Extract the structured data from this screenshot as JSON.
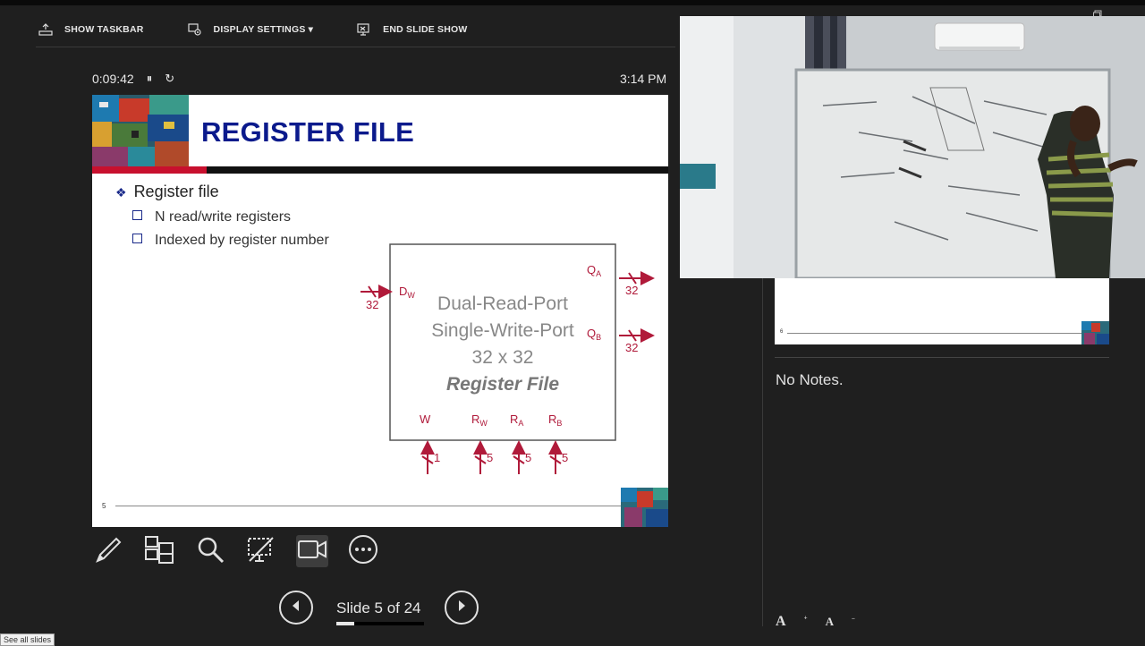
{
  "toolbar": {
    "show_taskbar": "SHOW TASKBAR",
    "display_settings": "DISPLAY SETTINGS ▾",
    "end_slide_show": "END SLIDE SHOW"
  },
  "timer": {
    "elapsed": "0:09:42",
    "pause": "⏸",
    "restart": "↻"
  },
  "clock": "3:14 PM",
  "slide": {
    "title": "REGISTER FILE",
    "bullet_main": "Register file",
    "bullets_sub": [
      "N read/write registers",
      "Indexed by register number"
    ],
    "page_number": "5",
    "diagram": {
      "block_lines": [
        "Dual-Read-Port",
        "Single-Write-Port",
        "32 x 32"
      ],
      "block_title": "Register File",
      "dw": "D",
      "dw_sub": "W",
      "dw_width": "32",
      "qa": "Q",
      "qa_sub": "A",
      "qa_width": "32",
      "qb": "Q",
      "qb_sub": "B",
      "qb_width": "32",
      "w_label": "W",
      "w_width": "1",
      "rw": "R",
      "rw_sub": "W",
      "rw_width": "5",
      "ra": "R",
      "ra_sub": "A",
      "ra_width": "5",
      "rb": "R",
      "rb_sub": "B",
      "rb_width": "5"
    }
  },
  "tools": [
    "pen-tool",
    "see-all-slides",
    "zoom",
    "black-screen",
    "camera-toggle",
    "more-options"
  ],
  "nav": {
    "slide_count": "Slide 5 of 24",
    "progress_fraction": 0.208
  },
  "see_all_slides_tooltip": "See all slides",
  "next_slide_preview": {
    "page_number": "6"
  },
  "notes": "No Notes.",
  "font_controls": {
    "increase": "A",
    "decrease": "A"
  }
}
